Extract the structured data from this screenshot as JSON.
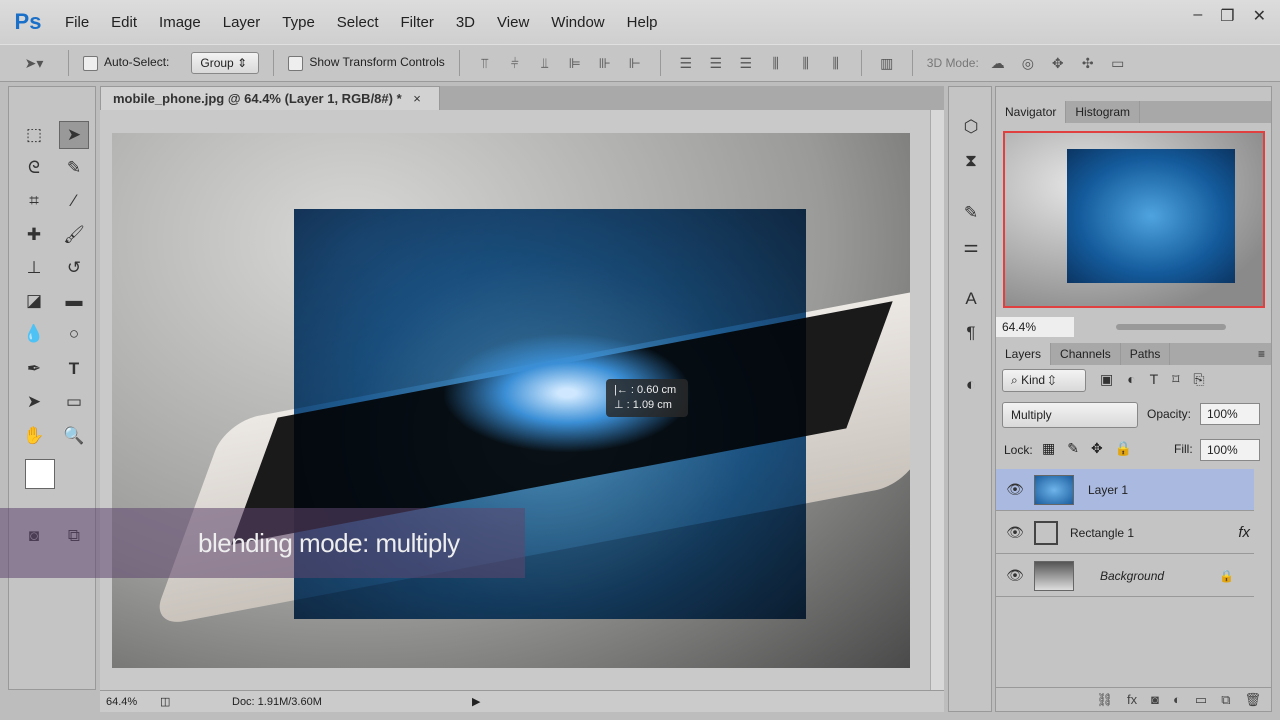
{
  "app": {
    "logo": "Ps",
    "menus": [
      "File",
      "Edit",
      "Image",
      "Layer",
      "Type",
      "Select",
      "Filter",
      "3D",
      "View",
      "Window",
      "Help"
    ],
    "window_controls": [
      "–",
      "❐",
      "✕"
    ]
  },
  "options": {
    "auto_select_label": "Auto-Select:",
    "auto_select_value": "Group",
    "show_transform_label": "Show Transform Controls",
    "mode_3d_label": "3D Mode:"
  },
  "document": {
    "tab_title": "mobile_phone.jpg @ 64.4% (Layer 1, RGB/8#) *",
    "close": "×",
    "zoom": "64.4%",
    "doc_size": "Doc: 1.91M/3.60M"
  },
  "tooltip": {
    "dx": "0.60 cm",
    "dy": "1.09 cm"
  },
  "caption": "blending mode: multiply",
  "navigator": {
    "tabs": [
      "Navigator",
      "Histogram"
    ],
    "zoom": "64.4%"
  },
  "layers_panel": {
    "tabs": [
      "Layers",
      "Channels",
      "Paths"
    ],
    "kind": "Kind",
    "blend_mode": "Multiply",
    "opacity_label": "Opacity:",
    "opacity": "100%",
    "lock_label": "Lock:",
    "fill_label": "Fill:",
    "fill": "100%",
    "layers": [
      {
        "name": "Layer 1",
        "selected": true
      },
      {
        "name": "Rectangle 1",
        "fx": "fx"
      },
      {
        "name": "Background",
        "locked": true
      }
    ]
  }
}
